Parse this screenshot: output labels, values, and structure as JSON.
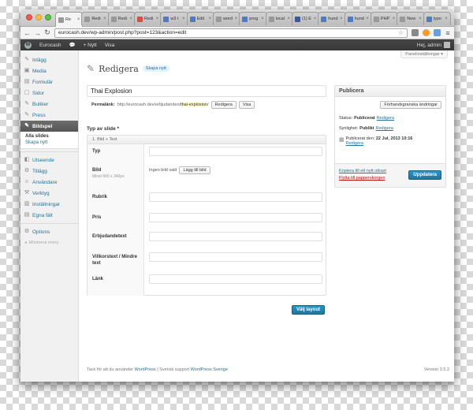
{
  "browser": {
    "tabs": [
      {
        "title": "Re",
        "color": "#999999"
      },
      {
        "title": "Redi",
        "color": "#999999"
      },
      {
        "title": "Redi",
        "color": "#999999"
      },
      {
        "title": "Redi",
        "color": "#d94f3c"
      },
      {
        "title": "w3 t",
        "color": "#4a7cc9"
      },
      {
        "title": "Edit",
        "color": "#4a7cc9"
      },
      {
        "title": "word",
        "color": "#999999"
      },
      {
        "title": "prog",
        "color": "#4a7cc9"
      },
      {
        "title": "local",
        "color": "#999999"
      },
      {
        "title": "(1) E",
        "color": "#3b5998"
      },
      {
        "title": "hund",
        "color": "#4a7cc9"
      },
      {
        "title": "hund",
        "color": "#4a7cc9"
      },
      {
        "title": "PHP",
        "color": "#999999"
      },
      {
        "title": "New",
        "color": "#999999"
      },
      {
        "title": "typo",
        "color": "#4a7cc9"
      }
    ],
    "active_tab": 0,
    "url": "eurocash.dev/wp-admin/post.php?post=123&action=edit"
  },
  "adminbar": {
    "site_name": "Eurocash",
    "new_label": "+ Nytt",
    "view_label": "Visa",
    "greeting": "Hej, admin"
  },
  "sidebar": {
    "items": [
      {
        "label": "Inlägg",
        "icon": "pin-icon"
      },
      {
        "label": "Media",
        "icon": "media-icon"
      },
      {
        "label": "Formulär",
        "icon": "form-icon"
      },
      {
        "label": "Sidor",
        "icon": "page-icon"
      },
      {
        "label": "Butiker",
        "icon": "store-icon"
      },
      {
        "label": "Press",
        "icon": "pin-icon"
      },
      {
        "label": "Bildspel",
        "icon": "pin-icon",
        "current": true
      }
    ],
    "submenu": [
      {
        "label": "Alla slides",
        "active": true
      },
      {
        "label": "Skapa nytt",
        "active": false
      }
    ],
    "items2": [
      {
        "label": "Utseende",
        "icon": "appearance-icon"
      },
      {
        "label": "Tillägg",
        "icon": "plugin-icon"
      },
      {
        "label": "Användare",
        "icon": "users-icon"
      },
      {
        "label": "Verktyg",
        "icon": "tools-icon"
      },
      {
        "label": "Inställningar",
        "icon": "settings-icon"
      },
      {
        "label": "Egna fält",
        "icon": "fields-icon"
      }
    ],
    "items3": [
      {
        "label": "Options",
        "icon": "options-icon"
      }
    ],
    "collapse_label": "Minimera meny"
  },
  "main": {
    "screen_options": "Panelinställningar ▾",
    "page_title": "Redigera",
    "add_new": "Skapa nytt",
    "post_title": "Thai Explosion",
    "permalink_label": "Permalänk:",
    "permalink_base": "http://eurocash.dev/erbjudanden/",
    "permalink_slug": "thai-explosion",
    "permalink_tail": "/",
    "edit_button": "Redigera",
    "view_button": "Visa",
    "section_label": "Typ av slide *",
    "box_header": "1. Bild + Text",
    "fields": [
      {
        "label": "Typ",
        "hint": "",
        "kind": "input"
      },
      {
        "label": "Bild",
        "hint": "Minst 660 x 340px",
        "kind": "image"
      },
      {
        "label": "Rubrik",
        "hint": "",
        "kind": "input"
      },
      {
        "label": "Pris",
        "hint": "",
        "kind": "input"
      },
      {
        "label": "Erbjudandetext",
        "hint": "",
        "kind": "input"
      },
      {
        "label": "Villkorstext / Mindre text",
        "hint": "",
        "kind": "input"
      },
      {
        "label": "Länk",
        "hint": "",
        "kind": "input"
      }
    ],
    "no_image_text": "Ingen bild vald",
    "add_image_button": "Lägg till bild",
    "layout_button": "Välj layout"
  },
  "publish": {
    "title": "Publicera",
    "preview_button": "Förhandsgranska ändringar",
    "status_label": "Status:",
    "status_value": "Publicerat",
    "status_edit": "Redigera",
    "visibility_label": "Synlighet:",
    "visibility_value": "Publikt",
    "visibility_edit": "Redigera",
    "published_label": "Publicerat den:",
    "published_value": "22 Jul, 2013 10:16",
    "published_edit": "Redigera",
    "copy_link": "Kopiera till ett nytt utkast",
    "trash_link": "Flytta till papperskorgen",
    "update_button": "Uppdatera"
  },
  "footer": {
    "thanks_prefix": "Tack för att du använder",
    "wordpress_link": "WordPress",
    "separator": "|",
    "support_prefix": "Svensk support",
    "support_link": "WordPress Sverige",
    "version": "Version 3.5.2"
  },
  "colors": {
    "link": "#21759b",
    "primary": "#21759b",
    "adminbar": "#464646",
    "trash": "#bc0b0b"
  }
}
